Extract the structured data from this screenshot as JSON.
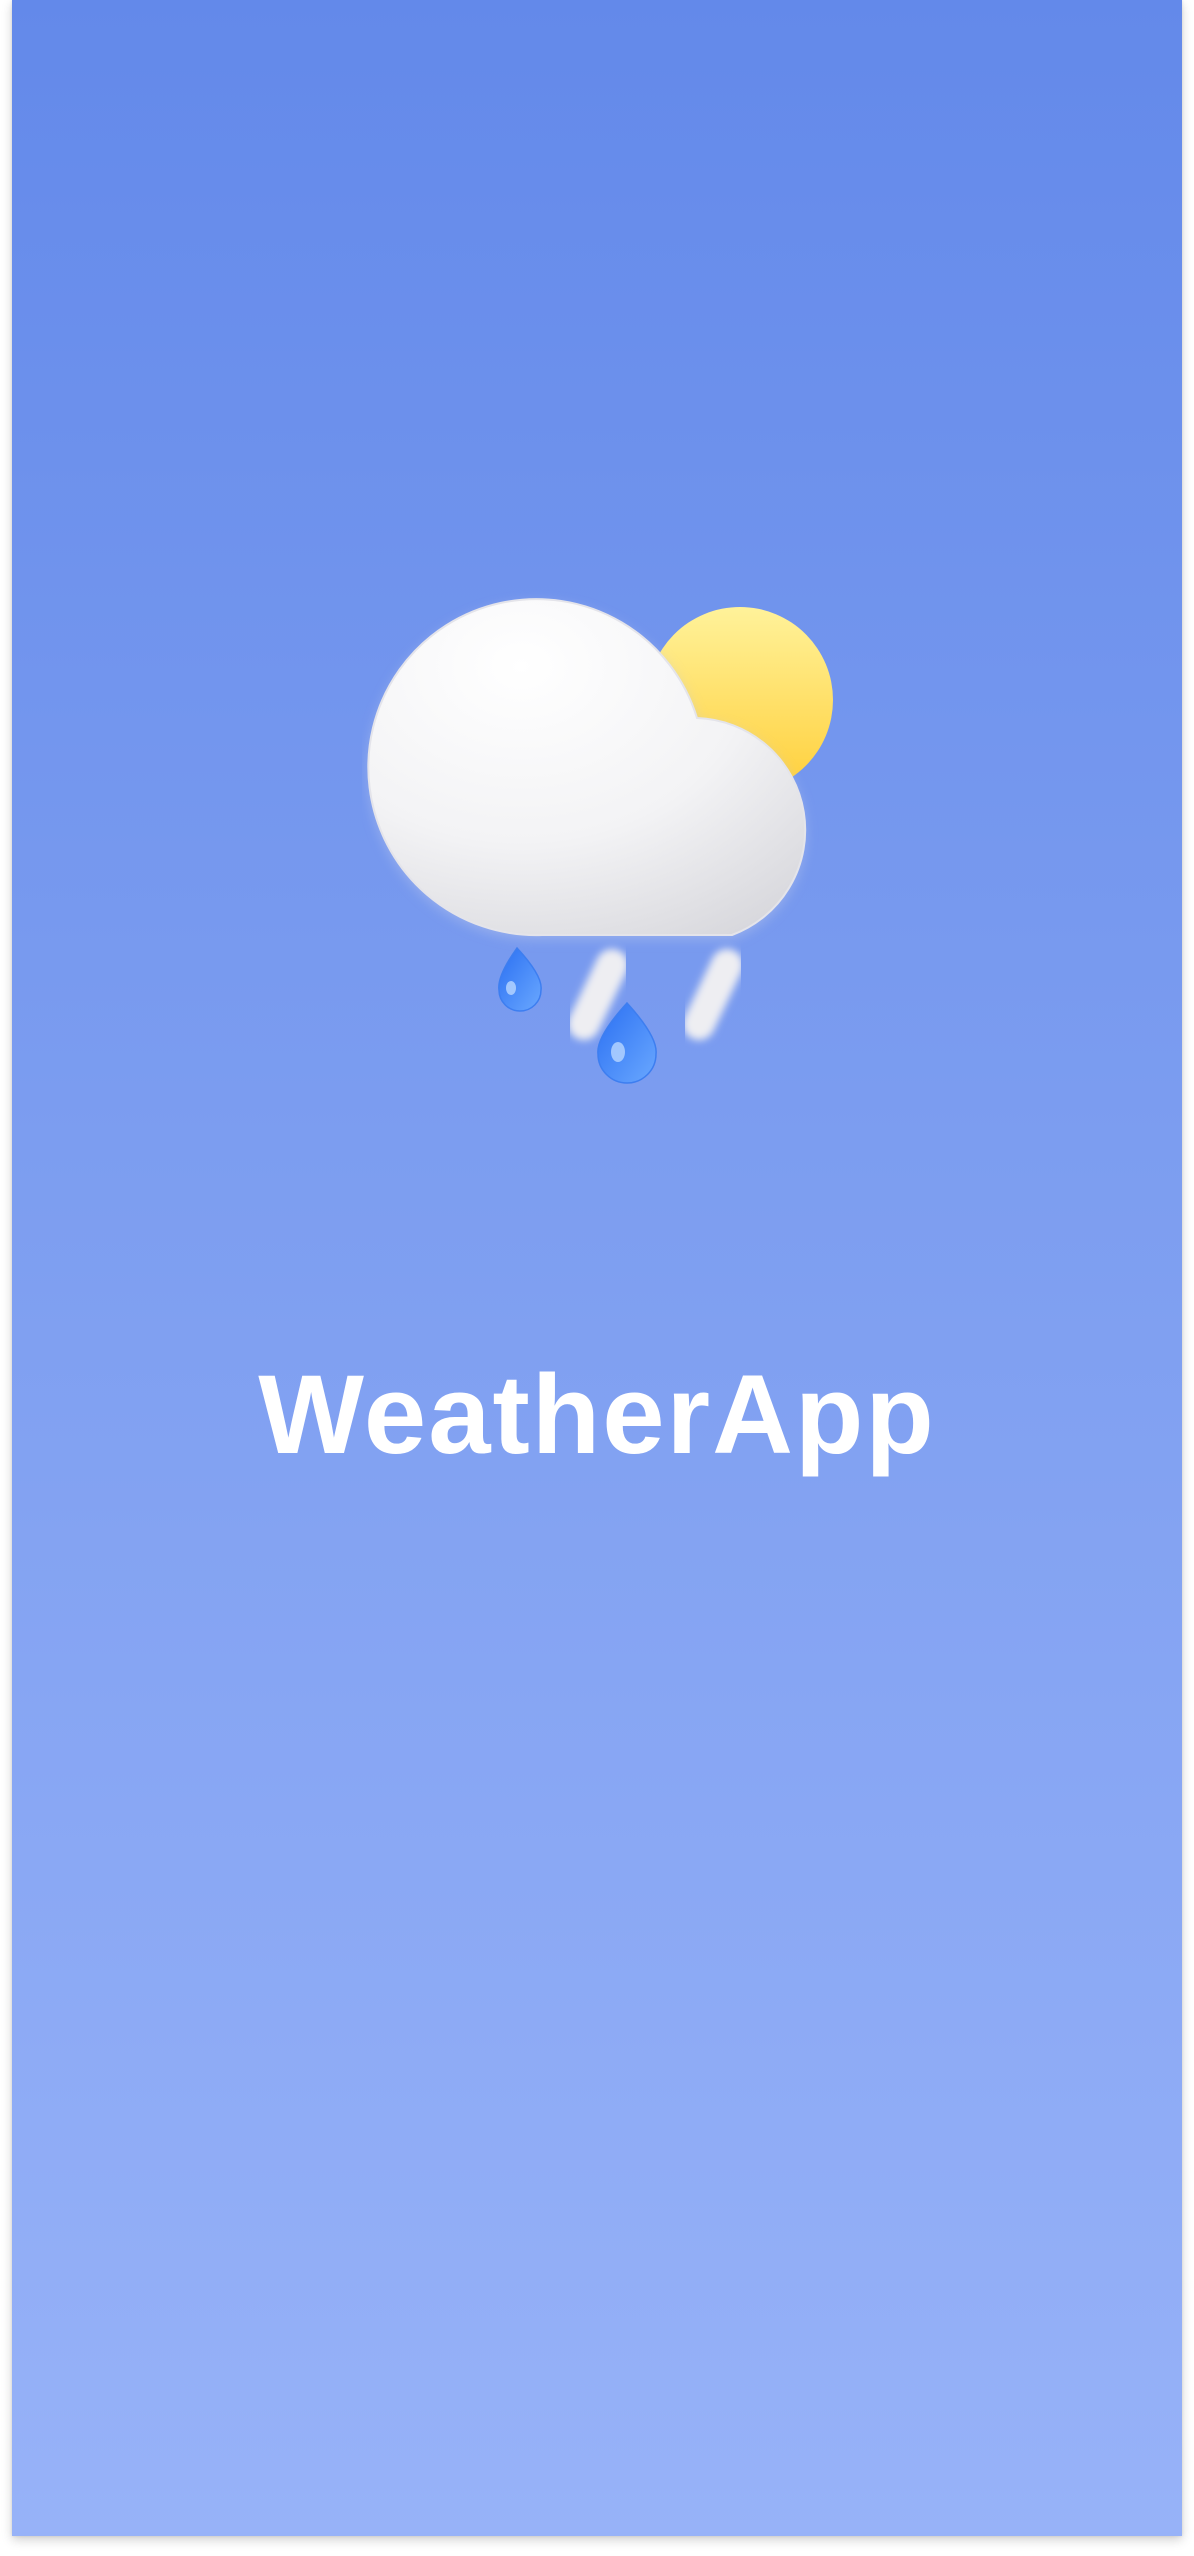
{
  "splash": {
    "app_name": "WeatherApp",
    "icon": "sun-cloud-rain-icon"
  },
  "colors": {
    "background_top": "#6389ea",
    "background_bottom": "#97b2f8",
    "sun": "#ffd84d",
    "cloud": "#ffffff",
    "raindrop": "#3b82f6",
    "text": "#ffffff"
  }
}
